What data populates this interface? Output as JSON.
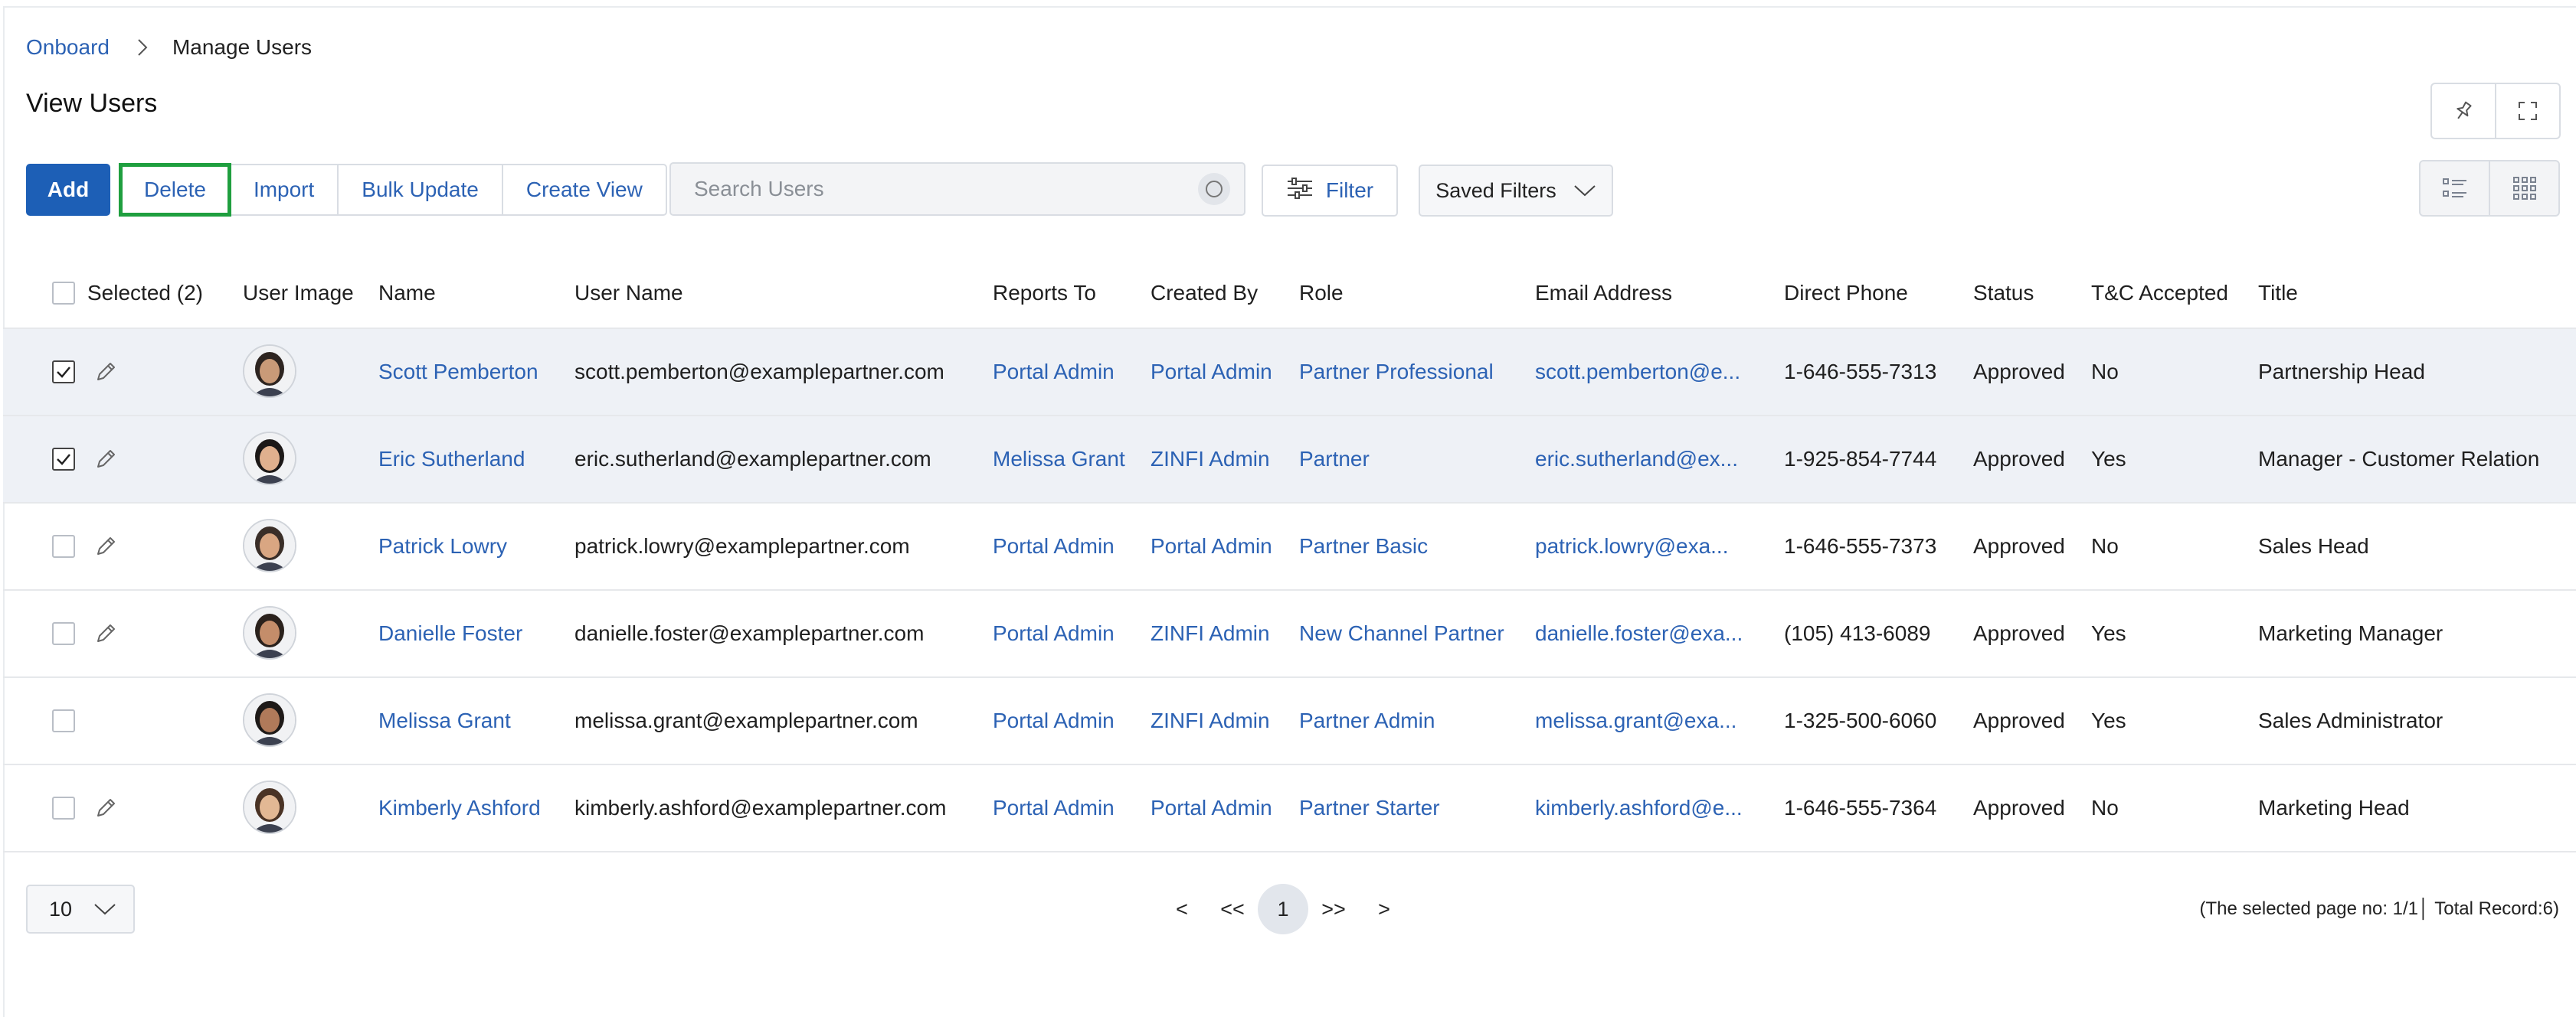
{
  "breadcrumb": {
    "root": "Onboard",
    "current": "Manage Users"
  },
  "page": {
    "title": "View Users"
  },
  "toolbar": {
    "add": "Add",
    "delete": "Delete",
    "import": "Import",
    "bulk_update": "Bulk Update",
    "create_view": "Create View",
    "search_placeholder": "Search Users",
    "filter": "Filter",
    "saved_filters": "Saved Filters"
  },
  "table": {
    "headers": {
      "selected": "Selected (2)",
      "user_image": "User Image",
      "name": "Name",
      "user_name": "User Name",
      "reports_to": "Reports To",
      "created_by": "Created By",
      "role": "Role",
      "email": "Email Address",
      "phone": "Direct Phone",
      "status": "Status",
      "tc": "T&C Accepted",
      "title": "Title"
    },
    "rows": [
      {
        "checked": true,
        "editable": true,
        "name": "Scott Pemberton",
        "user_name": "scott.pemberton@examplepartner.com",
        "reports_to": "Portal Admin",
        "created_by": "Portal Admin",
        "role": "Partner Professional",
        "email": "scott.pemberton@e...",
        "phone": "1-646-555-7313",
        "status": "Approved",
        "tc": "No",
        "title": "Partnership Head"
      },
      {
        "checked": true,
        "editable": true,
        "name": "Eric Sutherland",
        "user_name": "eric.sutherland@examplepartner.com",
        "reports_to": "Melissa Grant",
        "created_by": "ZINFI Admin",
        "role": "Partner",
        "email": "eric.sutherland@ex...",
        "phone": "1-925-854-7744",
        "status": "Approved",
        "tc": "Yes",
        "title": "Manager - Customer Relation"
      },
      {
        "checked": false,
        "editable": true,
        "name": "Patrick Lowry",
        "user_name": "patrick.lowry@examplepartner.com",
        "reports_to": "Portal Admin",
        "created_by": "Portal Admin",
        "role": "Partner Basic",
        "email": "patrick.lowry@exa...",
        "phone": "1-646-555-7373",
        "status": "Approved",
        "tc": "No",
        "title": "Sales Head"
      },
      {
        "checked": false,
        "editable": true,
        "name": "Danielle Foster",
        "user_name": "danielle.foster@examplepartner.com",
        "reports_to": "Portal Admin",
        "created_by": "ZINFI Admin",
        "role": "New Channel Partner",
        "email": "danielle.foster@exa...",
        "phone": "(105) 413-6089",
        "status": "Approved",
        "tc": "Yes",
        "title": "Marketing Manager"
      },
      {
        "checked": false,
        "editable": false,
        "name": "Melissa Grant",
        "user_name": "melissa.grant@examplepartner.com",
        "reports_to": "Portal Admin",
        "created_by": "ZINFI Admin",
        "role": "Partner Admin",
        "email": "melissa.grant@exa...",
        "phone": "1-325-500-6060",
        "status": "Approved",
        "tc": "Yes",
        "title": "Sales Administrator"
      },
      {
        "checked": false,
        "editable": true,
        "name": "Kimberly Ashford",
        "user_name": "kimberly.ashford@examplepartner.com",
        "reports_to": "Portal Admin",
        "created_by": "Portal Admin",
        "role": "Partner Starter",
        "email": "kimberly.ashford@e...",
        "phone": "1-646-555-7364",
        "status": "Approved",
        "tc": "No",
        "title": "Marketing Head"
      }
    ]
  },
  "pagination": {
    "page_size": "10",
    "prev": "<",
    "first": "<<",
    "current": "1",
    "last": ">>",
    "next": ">",
    "info": "(The selected page no: 1/1│ Total Record:6)"
  },
  "colors": {
    "accent": "#1d5fb6",
    "link": "#2c62b4",
    "highlight": "#1f9f3f",
    "selected_row": "#eef1f6"
  }
}
